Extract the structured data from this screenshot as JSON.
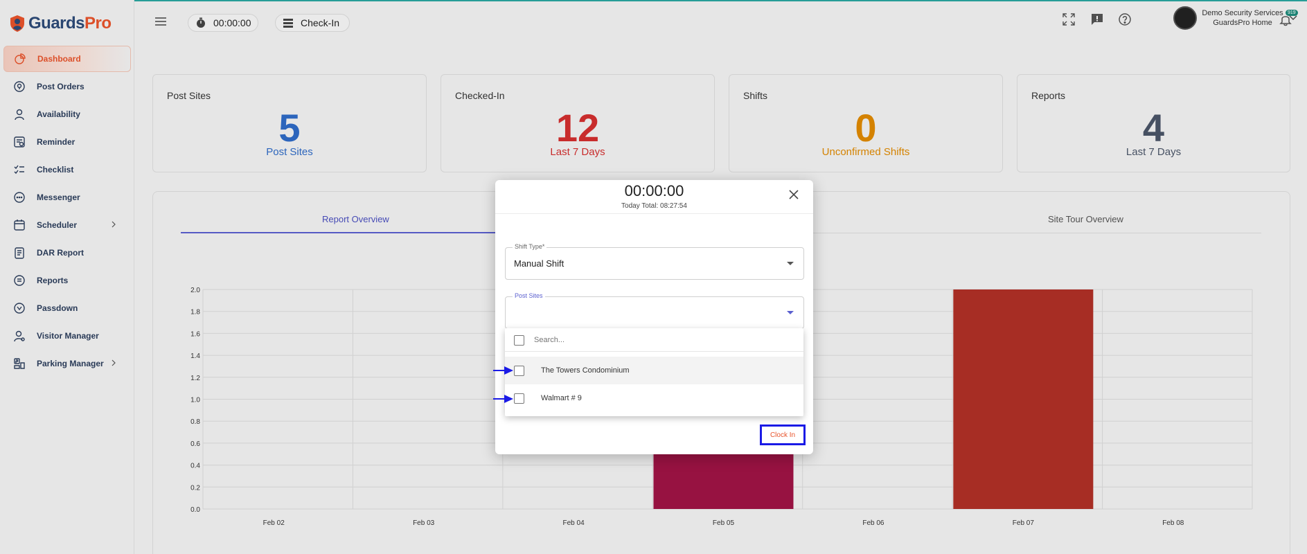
{
  "brand": {
    "name_part1": "Guards",
    "name_part2": "Pro"
  },
  "sidebar": {
    "items": [
      {
        "label": "Dashboard",
        "icon": "pie-chart-icon",
        "active": true
      },
      {
        "label": "Post Orders",
        "icon": "map-pin-icon"
      },
      {
        "label": "Availability",
        "icon": "user-icon"
      },
      {
        "label": "Reminder",
        "icon": "reminder-icon"
      },
      {
        "label": "Checklist",
        "icon": "checklist-icon"
      },
      {
        "label": "Messenger",
        "icon": "chat-icon"
      },
      {
        "label": "Scheduler",
        "icon": "calendar-icon",
        "expandable": true
      },
      {
        "label": "DAR Report",
        "icon": "clipboard-icon"
      },
      {
        "label": "Reports",
        "icon": "document-icon"
      },
      {
        "label": "Passdown",
        "icon": "passdown-icon"
      },
      {
        "label": "Visitor Manager",
        "icon": "visitor-icon"
      },
      {
        "label": "Parking Manager",
        "icon": "parking-icon",
        "expandable": true
      }
    ]
  },
  "header": {
    "timer": "00:00:00",
    "checkin_label": "Check-In",
    "notification_count": "919",
    "user_name": "Demo Security Services",
    "user_sub": "GuardsPro Home"
  },
  "cards": [
    {
      "title": "Post Sites",
      "value": "5",
      "subtitle": "Post Sites",
      "color": "#2f6bc7"
    },
    {
      "title": "Checked-In",
      "value": "12",
      "subtitle": "Last 7 Days",
      "color": "#d32f2f"
    },
    {
      "title": "Shifts",
      "value": "0",
      "subtitle": "Unconfirmed Shifts",
      "color": "#e08a00"
    },
    {
      "title": "Reports",
      "value": "4",
      "subtitle": "Last 7 Days",
      "color": "#4a5568"
    }
  ],
  "panel": {
    "tabs": [
      {
        "label": "Report Overview",
        "active": true
      },
      {
        "label": "Site Tour Overview",
        "active": false
      }
    ]
  },
  "chart_data": {
    "type": "bar",
    "categories": [
      "Feb 02",
      "Feb 03",
      "Feb 04",
      "Feb 05",
      "Feb 06",
      "Feb 07",
      "Feb 08"
    ],
    "values": [
      0,
      0,
      0,
      1,
      0,
      2,
      0
    ],
    "bar_colors": [
      "#a01445",
      "#a01445",
      "#a01445",
      "#a01445",
      "#a01445",
      "#b03026",
      "#a01445"
    ],
    "yticks": [
      "0.0",
      "0.2",
      "0.4",
      "0.6",
      "0.8",
      "1.0",
      "1.2",
      "1.4",
      "1.6",
      "1.8",
      "2.0"
    ],
    "ylim": [
      0,
      2
    ],
    "grid": true
  },
  "modal": {
    "timer": "00:00:00",
    "today_total": "Today Total: 08:27:54",
    "shift_type_label": "Shift Type*",
    "shift_type_value": "Manual Shift",
    "post_sites_label": "Post Sites",
    "post_sites_value": "",
    "clock_in_label": "Clock In"
  },
  "dropdown": {
    "search_placeholder": "Search...",
    "options": [
      {
        "label": "The Towers Condominium",
        "checked": false
      },
      {
        "label": "Walmart # 9",
        "checked": false
      }
    ]
  }
}
